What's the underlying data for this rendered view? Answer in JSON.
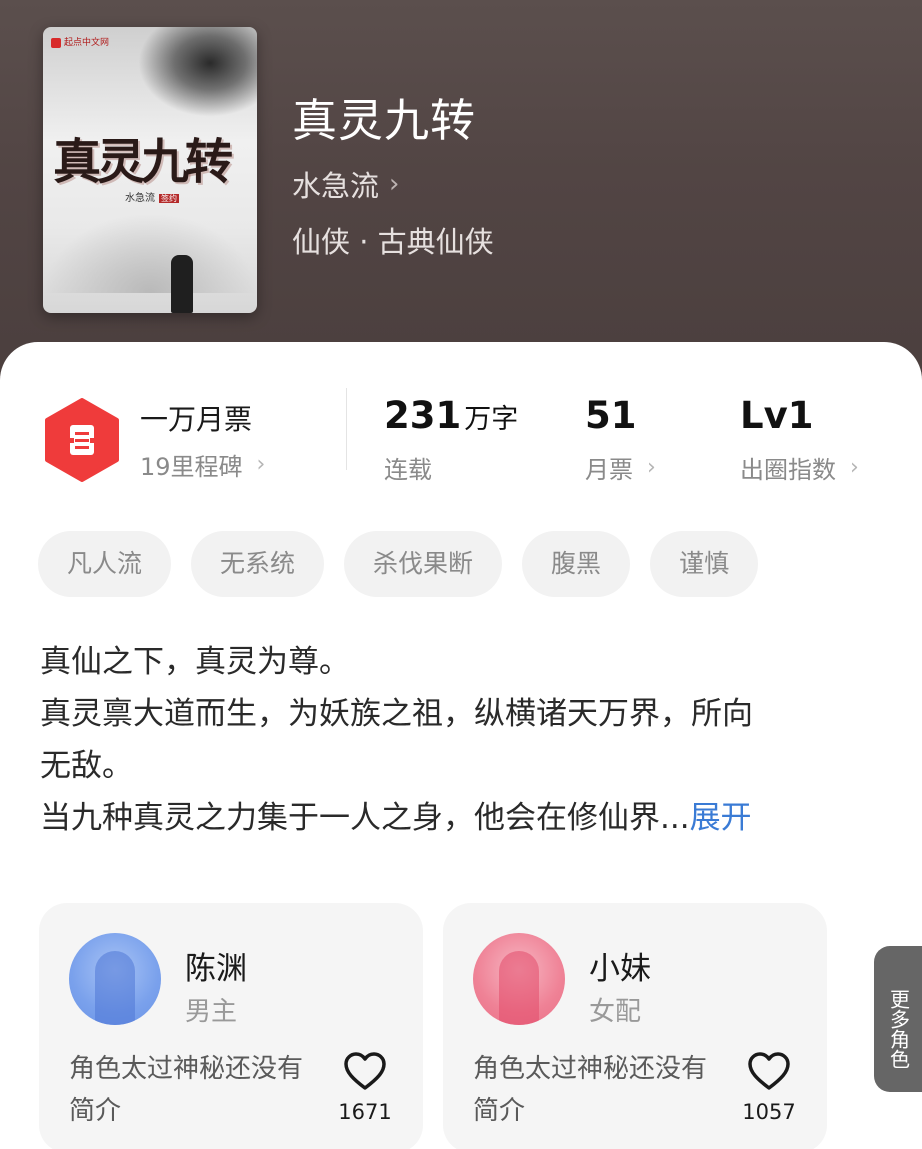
{
  "cover": {
    "publisher": "起点中文网",
    "title_art": "真灵九转",
    "author_art": "水急流",
    "tag_art": "签约"
  },
  "book": {
    "title": "真灵九转",
    "author": "水急流",
    "genre": "仙侠 · 古典仙侠"
  },
  "stats": {
    "ticket_main": "一万月票",
    "ticket_sub": "19里程碑",
    "words_value": "231",
    "words_unit": "万字",
    "words_label": "连载",
    "monthly_value": "51",
    "monthly_label": "月票",
    "level_value": "Lv1",
    "level_label": "出圈指数"
  },
  "tags": [
    "凡人流",
    "无系统",
    "杀伐果断",
    "腹黑",
    "谨慎"
  ],
  "intro": {
    "line1": "真仙之下，真灵为尊。",
    "line2": "真灵禀大道而生，为妖族之祖，纵横诸天万界，所向",
    "line3": "无敌。",
    "line4": "当九种真灵之力集于一人之身，他会在修仙界...",
    "expand": "展开"
  },
  "roles": [
    {
      "name": "陈渊",
      "type": "男主",
      "desc": "角色太过神秘还没有简介",
      "likes": "1671",
      "avatar_color": "#7aa1ec"
    },
    {
      "name": "小妹",
      "type": "女配",
      "desc": "角色太过神秘还没有简介",
      "likes": "1057",
      "avatar_color": "#ef8296"
    }
  ],
  "more_roles": "更多角色",
  "colors": {
    "accent_red": "#ef3b3b",
    "link_blue": "#3a7bd5"
  }
}
